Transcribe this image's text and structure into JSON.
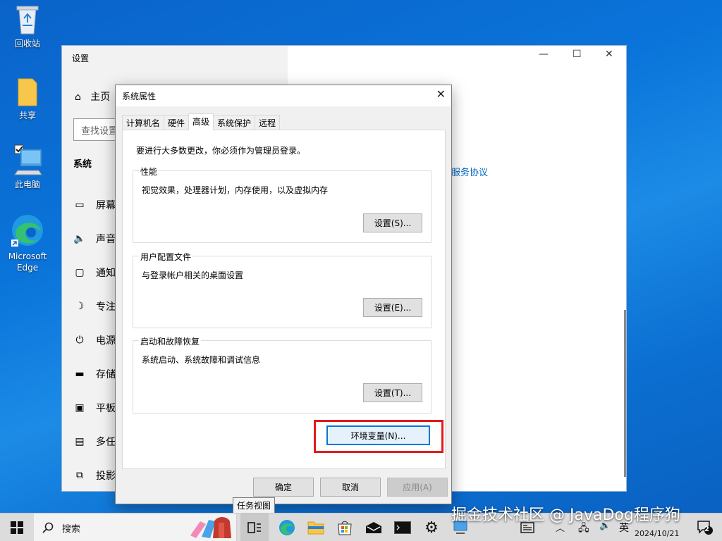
{
  "desktop": {
    "icons": [
      {
        "label": "回收站",
        "icon": "recycle-bin-icon"
      },
      {
        "label": "共享",
        "icon": "folder-icon"
      },
      {
        "label": "此电脑",
        "icon": "computer-icon"
      },
      {
        "label": "Microsoft Edge",
        "icon": "edge-icon"
      }
    ]
  },
  "settings": {
    "title": "设置",
    "home": "主页",
    "search_placeholder": "查找设置",
    "section": "系统",
    "nav": [
      "屏幕",
      "声音",
      "通知",
      "专注",
      "电源",
      "存储",
      "平板",
      "多任",
      "投影"
    ],
    "link": "服务协议",
    "controls": {
      "minimize": "—",
      "maximize": "☐",
      "close": "✕"
    }
  },
  "dialog": {
    "title": "系统属性",
    "close": "✕",
    "tabs": [
      "计算机名",
      "硬件",
      "高级",
      "系统保护",
      "远程"
    ],
    "active_tab": "高级",
    "admin_note": "要进行大多数更改，你必须作为管理员登录。",
    "groups": {
      "performance": {
        "legend": "性能",
        "desc": "视觉效果，处理器计划，内存使用，以及虚拟内存",
        "button": "设置(S)..."
      },
      "profile": {
        "legend": "用户配置文件",
        "desc": "与登录帐户相关的桌面设置",
        "button": "设置(E)..."
      },
      "startup": {
        "legend": "启动和故障恢复",
        "desc": "系统启动、系统故障和调试信息",
        "button": "设置(T)..."
      }
    },
    "env_button": "环境变量(N)...",
    "ok": "确定",
    "cancel": "取消",
    "apply": "应用(A)"
  },
  "tooltip": "任务视图",
  "taskbar": {
    "search": "搜索",
    "ime": "英",
    "time": "2024/10/21",
    "notification_count": "2"
  },
  "watermark": "掘金技术社区 @ JavaDog程序狗",
  "colors": {
    "accent": "#0078d7",
    "highlight": "#e01b1b",
    "link": "#0067c0"
  }
}
